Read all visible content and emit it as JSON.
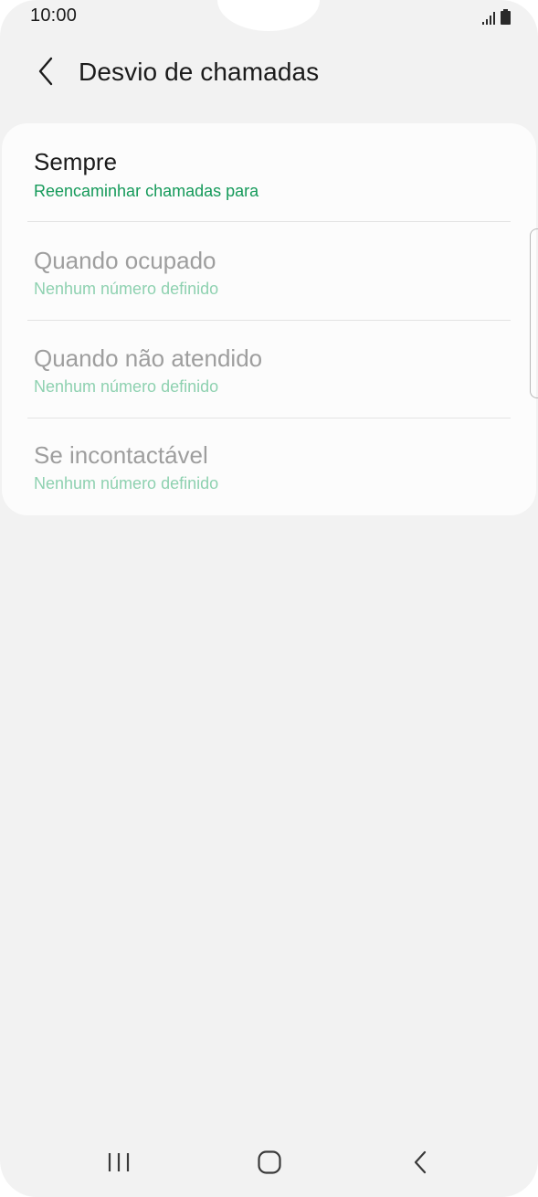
{
  "status_bar": {
    "time": "10:00",
    "signal_icon": "signal-bars-icon",
    "battery_icon": "battery-icon"
  },
  "header": {
    "back_icon": "chevron-left-icon",
    "title": "Desvio de chamadas"
  },
  "options": [
    {
      "title": "Sempre",
      "subtitle": "Reencaminhar chamadas para",
      "enabled": true
    },
    {
      "title": "Quando ocupado",
      "subtitle": "Nenhum número definido",
      "enabled": false
    },
    {
      "title": "Quando não atendido",
      "subtitle": "Nenhum número definido",
      "enabled": false
    },
    {
      "title": "Se incontactável",
      "subtitle": "Nenhum número definido",
      "enabled": false
    }
  ],
  "nav_bar": {
    "recents_icon": "recent-apps-icon",
    "home_icon": "home-icon",
    "back_icon": "back-icon"
  },
  "colors": {
    "accent": "#159a5a",
    "accent_disabled": "#8ed1b0",
    "background": "#f2f2f2",
    "card": "#fcfcfc"
  }
}
